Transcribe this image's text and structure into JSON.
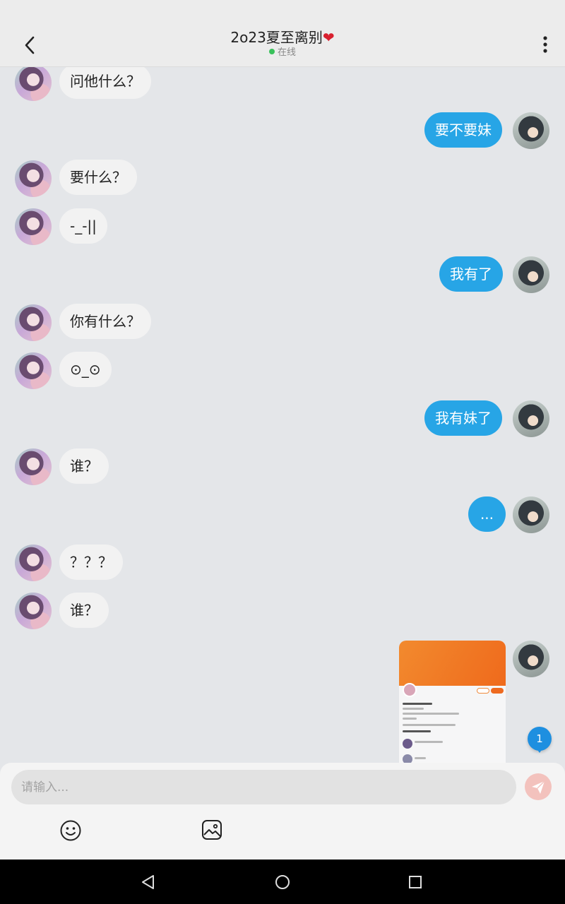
{
  "header": {
    "title": "2o23夏至离别",
    "heart": "❤",
    "status": "在线",
    "back_icon": "chevron-left-icon",
    "more_icon": "more-vertical-icon"
  },
  "messages": [
    {
      "side": "left",
      "text": "问他什么？"
    },
    {
      "side": "right",
      "text": "要不要妹"
    },
    {
      "side": "left",
      "text": "要什么？"
    },
    {
      "side": "left",
      "text": "-_-||"
    },
    {
      "side": "right",
      "text": "我有了"
    },
    {
      "side": "left",
      "text": "你有什么？"
    },
    {
      "side": "left",
      "text": "⊙_⊙"
    },
    {
      "side": "right",
      "text": "我有妹了"
    },
    {
      "side": "left",
      "text": "谁？"
    },
    {
      "side": "right",
      "text": "..."
    },
    {
      "side": "left",
      "text": "？？？"
    },
    {
      "side": "left",
      "text": "谁？"
    }
  ],
  "unread_count": "1",
  "input": {
    "placeholder": "请输入...",
    "value": "",
    "send_icon": "send-icon",
    "emoji_icon": "emoji-icon",
    "image_icon": "image-icon"
  },
  "colors": {
    "accent": "#27a5e6",
    "online": "#3ac15b",
    "badge": "#1e8fe0"
  }
}
